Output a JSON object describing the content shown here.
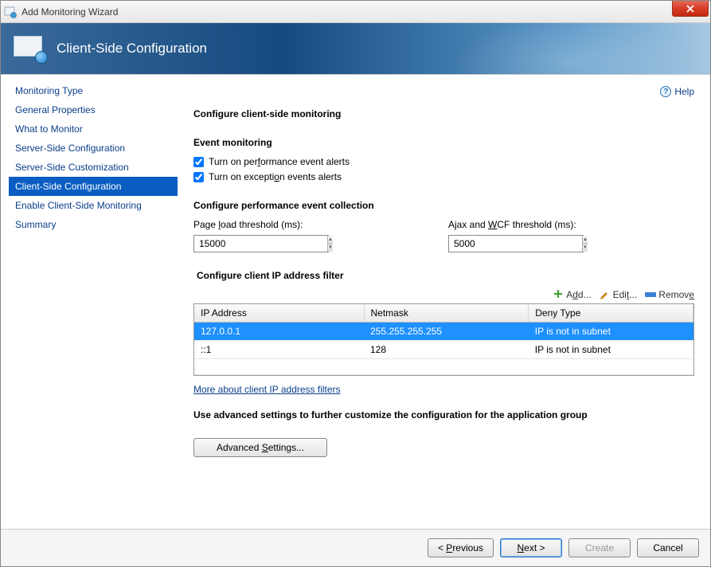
{
  "window": {
    "title": "Add Monitoring Wizard"
  },
  "banner": {
    "title": "Client-Side Configuration"
  },
  "help": {
    "label": "Help"
  },
  "sidebar": {
    "items": [
      {
        "label": "Monitoring Type"
      },
      {
        "label": "General Properties"
      },
      {
        "label": "What to Monitor"
      },
      {
        "label": "Server-Side Configuration"
      },
      {
        "label": "Server-Side Customization"
      },
      {
        "label": "Client-Side Configuration"
      },
      {
        "label": "Enable Client-Side Monitoring"
      },
      {
        "label": "Summary"
      }
    ],
    "active_index": 5
  },
  "main": {
    "heading": "Configure client-side monitoring",
    "event_monitoring": {
      "title": "Event monitoring",
      "perf_checkbox": {
        "prefix": "Turn on per",
        "u": "f",
        "suffix": "ormance event alerts",
        "checked": true
      },
      "exc_checkbox": {
        "prefix": "Turn on excepti",
        "u": "o",
        "suffix": "n events alerts",
        "checked": true
      }
    },
    "perf_collection": {
      "title": "Configure performance event collection",
      "page_load": {
        "prefix": "Page ",
        "u": "l",
        "suffix": "oad threshold (ms):",
        "value": "15000"
      },
      "ajax_wcf": {
        "prefix": "Ajax and ",
        "u": "W",
        "suffix": "CF threshold (ms):",
        "value": "5000"
      }
    },
    "ip_filter": {
      "title": "Configure client IP address filter",
      "toolbar": {
        "add": {
          "text": "A",
          "u": "d",
          "suffix": "d..."
        },
        "edit": {
          "text": "Edi",
          "u": "t",
          "suffix": "..."
        },
        "remove": {
          "text": "Remov",
          "u": "e",
          "suffix": ""
        }
      },
      "columns": {
        "ip": "IP Address",
        "netmask": "Netmask",
        "deny": "Deny Type"
      },
      "rows": [
        {
          "ip": "127.0.0.1",
          "netmask": "255.255.255.255",
          "deny": "IP is not in subnet",
          "selected": true
        },
        {
          "ip": "::1",
          "netmask": "128",
          "deny": "IP is not in subnet",
          "selected": false
        }
      ],
      "link": "More about client IP address filters"
    },
    "advanced": {
      "text": "Use advanced settings to further customize the configuration for the application group",
      "button": {
        "prefix": "Advanced ",
        "u": "S",
        "suffix": "ettings..."
      }
    }
  },
  "footer": {
    "previous": {
      "prefix": "< ",
      "u": "P",
      "suffix": "revious"
    },
    "next": {
      "u": "N",
      "suffix": "ext >"
    },
    "create": {
      "label": "Create"
    },
    "cancel": {
      "label": "Cancel"
    }
  }
}
